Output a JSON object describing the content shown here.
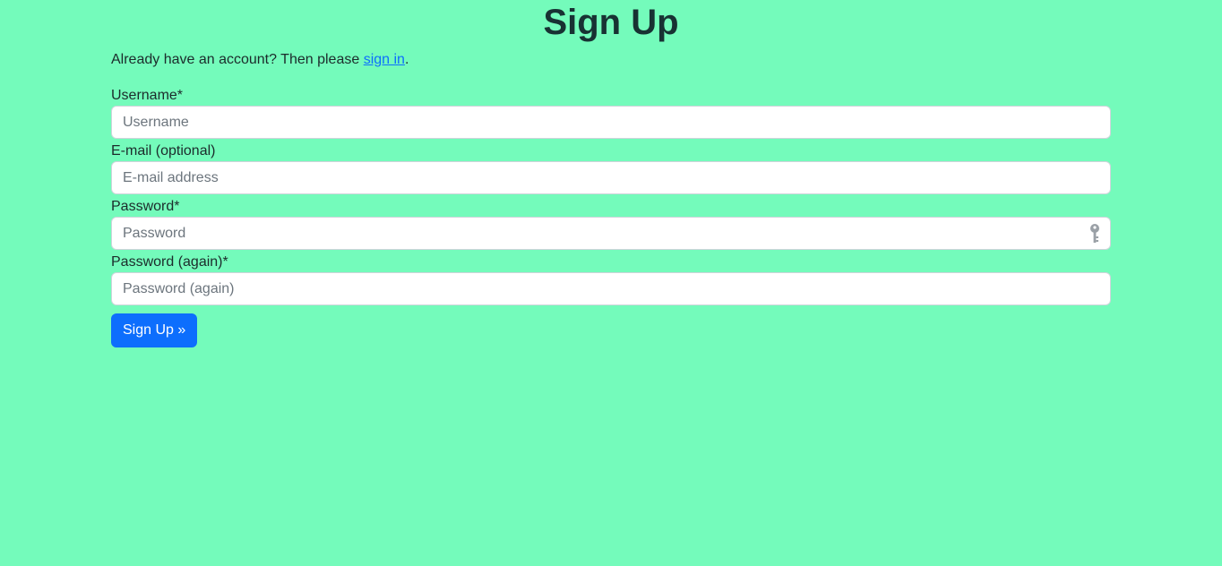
{
  "page": {
    "title": "Sign Up",
    "intro_text": "Already have an account? Then please ",
    "intro_link": "sign in",
    "intro_end": "."
  },
  "form": {
    "username": {
      "label": "Username*",
      "placeholder": "Username",
      "value": ""
    },
    "email": {
      "label": "E-mail (optional)",
      "placeholder": "E-mail address",
      "value": ""
    },
    "password": {
      "label": "Password*",
      "placeholder": "Password",
      "value": "",
      "icon": "key-icon"
    },
    "password_again": {
      "label": "Password (again)*",
      "placeholder": "Password (again)",
      "value": ""
    },
    "submit_label": "Sign Up »"
  },
  "colors": {
    "background": "#74fbbb",
    "primary": "#0d6efd",
    "heading": "#183233"
  }
}
